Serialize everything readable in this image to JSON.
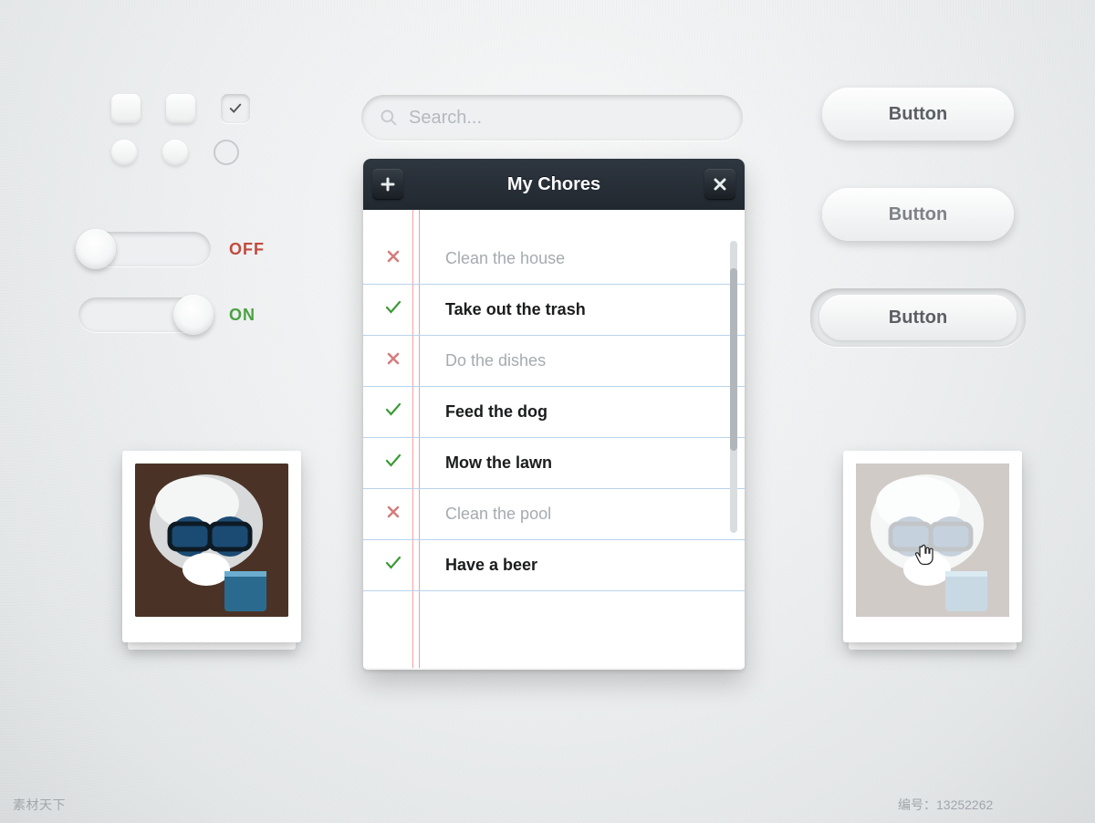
{
  "search": {
    "placeholder": "Search..."
  },
  "toggles": {
    "off_label": "OFF",
    "on_label": "ON"
  },
  "buttons": {
    "b1": "Button",
    "b2": "Button",
    "b3": "Button"
  },
  "panel": {
    "title": "My Chores",
    "items": [
      {
        "text": "Clean the house",
        "done": false
      },
      {
        "text": "Take out the trash",
        "done": true
      },
      {
        "text": "Do the dishes",
        "done": false
      },
      {
        "text": "Feed the dog",
        "done": true
      },
      {
        "text": "Mow the lawn",
        "done": true
      },
      {
        "text": "Clean the pool",
        "done": false
      },
      {
        "text": "Have a beer",
        "done": true
      }
    ]
  },
  "footer": {
    "image_id": "13252262",
    "credit_prefix": "编号：",
    "credit_id": "13252262",
    "site": "素材天下"
  }
}
